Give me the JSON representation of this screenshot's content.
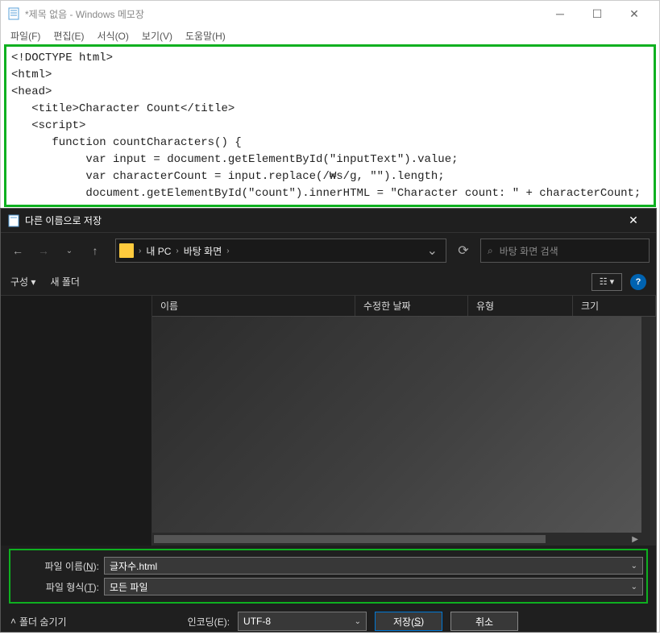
{
  "notepad": {
    "title": "*제목 없음 - Windows 메모장",
    "menu": {
      "file": "파일(F)",
      "edit": "편집(E)",
      "format": "서식(O)",
      "view": "보기(V)",
      "help": "도움말(H)"
    },
    "content": "<!DOCTYPE html>\n<html>\n<head>\n   <title>Character Count</title>\n   <script>\n      function countCharacters() {\n           var input = document.getElementById(\"inputText\").value;\n           var characterCount = input.replace(/₩s/g, \"\").length;\n           document.getElementById(\"count\").innerHTML = \"Character count: \" + characterCount;\n      }"
  },
  "savedlg": {
    "title": "다른 이름으로 저장",
    "breadcrumb": {
      "pc": "내 PC",
      "desktop": "바탕 화면"
    },
    "search_placeholder": "바탕 화면 검색",
    "toolbar": {
      "organize": "구성 ▾",
      "newfolder": "새 폴더"
    },
    "columns": {
      "name": "이름",
      "modified": "수정한 날짜",
      "type": "유형",
      "size": "크기"
    },
    "filename_label_pre": "파일 이름(",
    "filename_label_ul": "N",
    "filename_label_post": "):",
    "filetype_label_pre": "파일 형식(",
    "filetype_label_ul": "T",
    "filetype_label_post": "):",
    "filename_value": "글자수.html",
    "filetype_value": "모든 파일",
    "hide_folders": "폴더 숨기기",
    "encoding_label_pre": "인코딩(",
    "encoding_label_ul": "E",
    "encoding_label_post": "):",
    "encoding_value": "UTF-8",
    "save_btn_pre": "저장(",
    "save_btn_ul": "S",
    "save_btn_post": ")",
    "cancel_btn": "취소"
  }
}
